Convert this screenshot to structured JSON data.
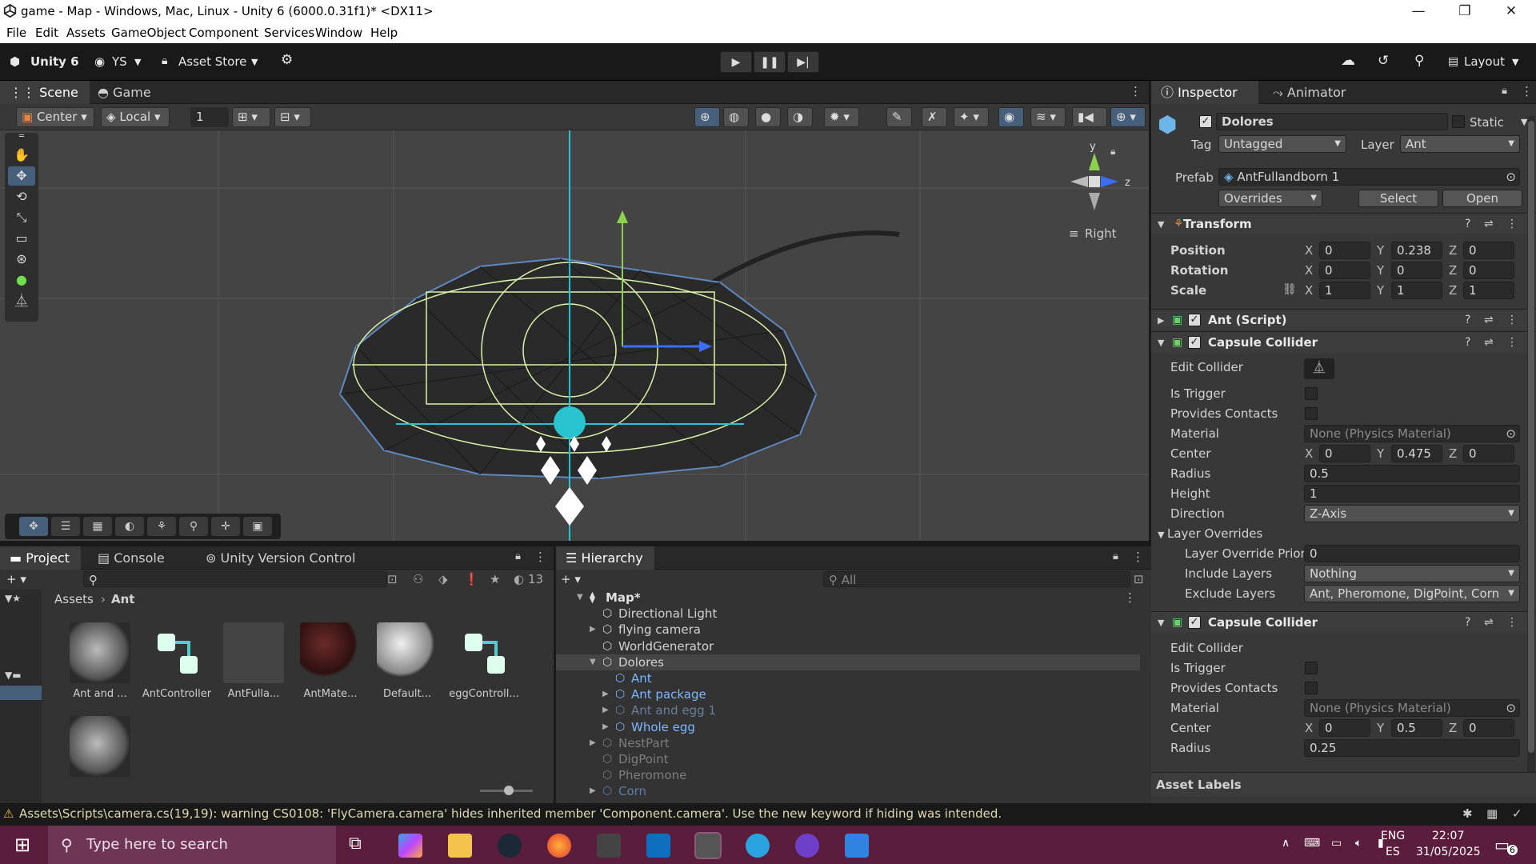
{
  "window": {
    "title": "game - Map - Windows, Mac, Linux - Unity 6 (6000.0.31f1)* <DX11>"
  },
  "menu": [
    "File",
    "Edit",
    "Assets",
    "GameObject",
    "Component",
    "Services",
    "Window",
    "Help"
  ],
  "toolbar": {
    "unity_label": "Unity 6",
    "account": "YS",
    "asset_store": "Asset Store",
    "layout": "Layout"
  },
  "scene": {
    "tabs": [
      "Scene",
      "Game"
    ],
    "pivot": "Center",
    "space": "Local",
    "grid_value": "1",
    "orientation_label": "Right",
    "gizmo_axes": {
      "y": "y",
      "z": "z"
    }
  },
  "inspector": {
    "tabs": [
      "Inspector",
      "Animator"
    ],
    "object_name": "Dolores",
    "static_label": "Static",
    "tag_label": "Tag",
    "tag_value": "Untagged",
    "layer_label": "Layer",
    "layer_value": "Ant",
    "prefab_label": "Prefab",
    "prefab_value": "AntFullandborn 1",
    "overrides": "Overrides",
    "select": "Select",
    "open": "Open",
    "transform": {
      "title": "Transform",
      "position_label": "Position",
      "rotation_label": "Rotation",
      "scale_label": "Scale",
      "position": {
        "x": "0",
        "y": "0.238",
        "z": "0"
      },
      "rotation": {
        "x": "0",
        "y": "0",
        "z": "0"
      },
      "scale": {
        "x": "1",
        "y": "1",
        "z": "1"
      }
    },
    "ant_script": "Ant (Script)",
    "capsule1": {
      "title": "Capsule Collider",
      "edit_collider": "Edit Collider",
      "is_trigger": "Is Trigger",
      "provides_contacts": "Provides Contacts",
      "material_label": "Material",
      "material": "None (Physics Material)",
      "center_label": "Center",
      "center": {
        "x": "0",
        "y": "0.475",
        "z": "0"
      },
      "radius_label": "Radius",
      "radius": "0.5",
      "height_label": "Height",
      "height": "1",
      "direction_label": "Direction",
      "direction": "Z-Axis",
      "layer_overrides": "Layer Overrides",
      "priority_label": "Layer Override Priori",
      "priority": "0",
      "include_label": "Include Layers",
      "include": "Nothing",
      "exclude_label": "Exclude Layers",
      "exclude": "Ant, Pheromone, DigPoint, Corn"
    },
    "capsule2": {
      "title": "Capsule Collider",
      "edit_collider": "Edit Collider",
      "is_trigger": "Is Trigger",
      "provides_contacts": "Provides Contacts",
      "material_label": "Material",
      "material": "None (Physics Material)",
      "center_label": "Center",
      "center": {
        "x": "0",
        "y": "0.5",
        "z": "0"
      },
      "radius_label": "Radius",
      "radius": "0.25"
    },
    "asset_labels": "Asset Labels"
  },
  "project": {
    "tabs": [
      "Project",
      "Console",
      "Unity Version Control"
    ],
    "breadcrumb": [
      "Assets",
      "Ant"
    ],
    "hidden_count": "13",
    "assets": [
      "Ant and ...",
      "AntController",
      "AntFulla...",
      "AntMate...",
      "Default...",
      "eggControll..."
    ]
  },
  "hierarchy": {
    "tab": "Hierarchy",
    "search_placeholder": "All",
    "rows": [
      {
        "label": "Map*",
        "indent": 0,
        "bold": true,
        "arrow": "▼",
        "color": "#e0e0e0"
      },
      {
        "label": "Directional Light",
        "indent": 1,
        "arrow": "",
        "color": "#d2d2d2"
      },
      {
        "label": "flying camera",
        "indent": 1,
        "arrow": "▶",
        "color": "#d2d2d2"
      },
      {
        "label": "WorldGenerator",
        "indent": 1,
        "arrow": "",
        "color": "#d2d2d2"
      },
      {
        "label": "Dolores",
        "indent": 1,
        "arrow": "▼",
        "color": "#d2d2d2",
        "sel": true
      },
      {
        "label": "Ant",
        "indent": 2,
        "arrow": "",
        "color": "#7fb7ff"
      },
      {
        "label": "Ant package",
        "indent": 2,
        "arrow": "▶",
        "color": "#7fb7ff"
      },
      {
        "label": "Ant and egg 1",
        "indent": 2,
        "arrow": "▶",
        "color": "#6a7f99"
      },
      {
        "label": "Whole egg",
        "indent": 2,
        "arrow": "▶",
        "color": "#7fb7ff"
      },
      {
        "label": "NestPart",
        "indent": 1,
        "arrow": "▶",
        "color": "#7d7d7d"
      },
      {
        "label": "DigPoint",
        "indent": 1,
        "arrow": "",
        "color": "#7d7d7d"
      },
      {
        "label": "Pheromone",
        "indent": 1,
        "arrow": "",
        "color": "#7d7d7d"
      },
      {
        "label": "Corn",
        "indent": 1,
        "arrow": "▶",
        "color": "#5d7da8"
      }
    ]
  },
  "status": {
    "message": "Assets\\Scripts\\camera.cs(19,19): warning CS0108: 'FlyCamera.camera' hides inherited member 'Component.camera'. Use the new keyword if hiding was intended."
  },
  "taskbar": {
    "search_placeholder": "Type here to search",
    "lang1": "ENG",
    "lang2": "ES",
    "time": "22:07",
    "date": "31/05/2025",
    "notif": "6"
  }
}
